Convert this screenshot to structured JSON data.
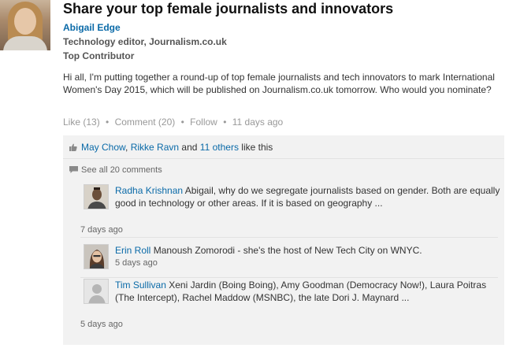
{
  "post": {
    "title": "Share your top female journalists and innovators",
    "author": "Abigail Edge",
    "headline": "Technology editor, Journalism.co.uk",
    "badge": "Top Contributor",
    "body": "Hi all, I'm putting together a round-up of top female journalists and tech innovators to mark International Women's Day 2015, which will be published on Journalism.co.uk tomorrow. Who would you nominate?",
    "actions": {
      "like": "Like (13)",
      "comment": "Comment (20)",
      "follow": "Follow",
      "time": "11 days ago",
      "separator": "•"
    }
  },
  "likes": {
    "first": "May Chow",
    "separator": ",",
    "second": "Rikke Ravn",
    "and": "and",
    "others": "11 others",
    "suffix": "like this"
  },
  "comments_link": "See all 20 comments",
  "comments": [
    {
      "author": "Radha Krishnan",
      "text": "Abigail, why do we segregate journalists based on gender. Both are equally good in technology or other areas. If it is based on geography ...",
      "time": "7 days ago"
    },
    {
      "author": "Erin Roll",
      "text": "Manoush Zomorodi - she's the host of New Tech City on WNYC.",
      "time": "5 days ago"
    },
    {
      "author": "Tim Sullivan",
      "text": "Xeni Jardin (Boing Boing), Amy Goodman (Democracy Now!), Laura Poitras (The Intercept), Rachel Maddow (MSNBC), the late Dori J. Maynard ...",
      "time": "5 days ago"
    }
  ],
  "colors": {
    "link": "#0a6aa8",
    "muted": "#999999",
    "panel": "#f2f2f2"
  }
}
